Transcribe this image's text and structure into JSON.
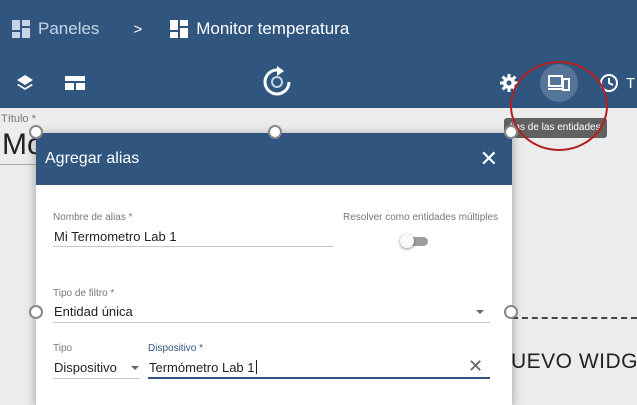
{
  "breadcrumb": {
    "parent": "Paneles",
    "separator": ">",
    "current": "Monitor temperatura"
  },
  "toolbar": {
    "right_text_partial": "T"
  },
  "tooltip": {
    "text": "lias de las entidades"
  },
  "canvas": {
    "title_label": "Título *",
    "title_value": "Mo",
    "widget_text": "UEVO WIDGE"
  },
  "dialog": {
    "title": "Agregar alias",
    "alias_name": {
      "label": "Nombre de alias *",
      "value": "Mi Termometro Lab 1"
    },
    "multi_entities": {
      "label": "Resolver como entidades múltiples",
      "checked": false
    },
    "filter_type": {
      "label": "Tipo de filtro *",
      "value": "Entidad única"
    },
    "type": {
      "label": "Tipo",
      "value": "Dispositivo"
    },
    "device": {
      "label": "Dispositivo *",
      "value": "Termómetro Lab 1"
    }
  },
  "colors": {
    "primary": "#305680",
    "highlight_circle": "#b51f1f"
  },
  "icons": [
    "dashboard-grid-icon",
    "layers-icon",
    "layout-icon",
    "refresh-icon",
    "gear-icon",
    "entity-aliases-icon",
    "clock-icon",
    "close-icon",
    "clear-icon",
    "dropdown-arrow-icon"
  ]
}
